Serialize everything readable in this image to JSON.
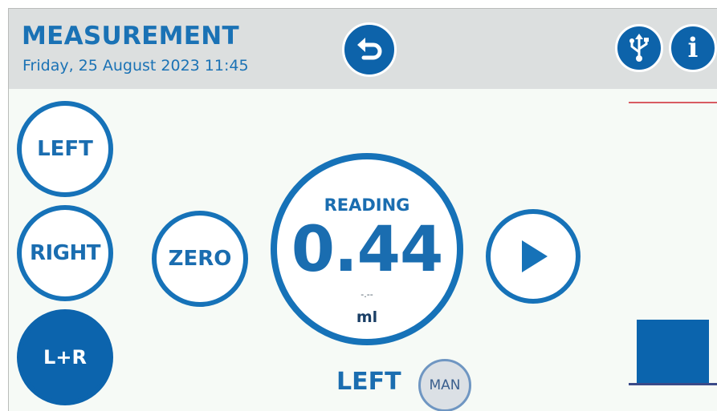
{
  "header": {
    "title": "MEASUREMENT",
    "datetime": "Friday, 25 August 2023 11:45",
    "back_icon": "back-arrow-icon",
    "usb_icon": "usb-icon",
    "info_icon": "info-icon",
    "info_glyph": "i"
  },
  "side_buttons": {
    "left": "LEFT",
    "right": "RIGHT",
    "both": "L+R"
  },
  "zero_label": "ZERO",
  "play_icon": "play-icon",
  "reading": {
    "label": "READING",
    "value": "0.44",
    "sub": "-.--",
    "unit": "ml"
  },
  "active_side": "LEFT",
  "mode": "MAN",
  "colors": {
    "accent": "#1672b8",
    "filled": "#0c64ad",
    "limit_line": "#d85b62"
  }
}
